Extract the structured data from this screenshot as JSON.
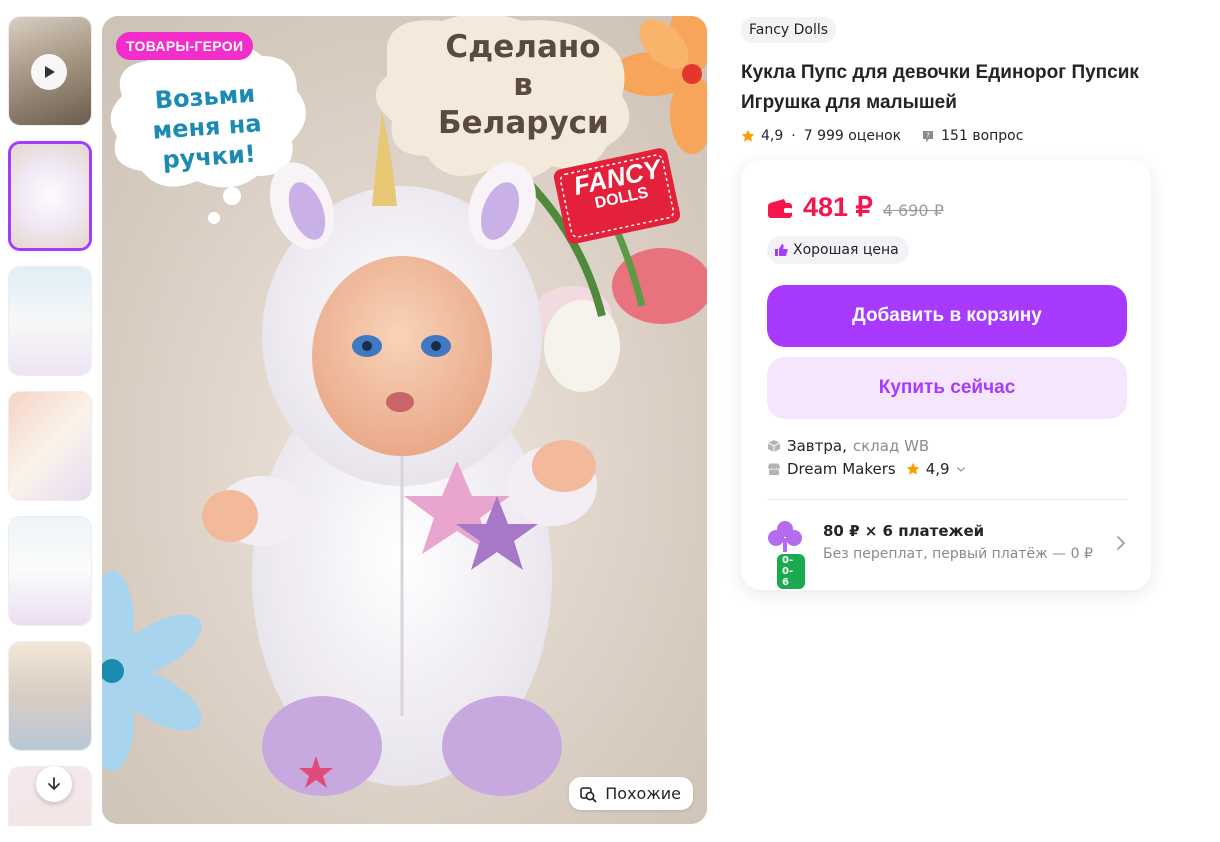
{
  "gallery": {
    "thumbnails": [
      {
        "name": "video",
        "active": false
      },
      {
        "name": "photo-1",
        "active": true
      },
      {
        "name": "photo-2",
        "active": false
      },
      {
        "name": "photo-3",
        "active": false
      },
      {
        "name": "photo-4",
        "active": false
      },
      {
        "name": "photo-5",
        "active": false
      },
      {
        "name": "photo-6",
        "active": false
      }
    ],
    "play_icon": "play-icon",
    "down_icon": "arrow-down-icon"
  },
  "main_image": {
    "badge": "ТОВАРЫ-ГЕРОИ",
    "cloud_text": "Возьми меня на ручки!",
    "made_in_text": "Сделано в Беларуси",
    "logo_line1": "FANCY",
    "logo_line2": "DOLLS",
    "similar_label": "Похожие",
    "similar_icon": "similar-search-icon"
  },
  "product": {
    "brand": "Fancy Dolls",
    "title": "Кукла Пупс для девочки Единорог Пупсик Игрушка для малышей",
    "rating": "4,9",
    "reviews": "7 999 оценок",
    "questions": "151 вопрос"
  },
  "offer": {
    "price": "481 ₽",
    "old_price": "4 690 ₽",
    "good_price_label": "Хорошая цена",
    "add_to_cart": "Добавить в корзину",
    "buy_now": "Купить сейчас",
    "delivery_day": "Завтра,",
    "delivery_warehouse": "склад WB",
    "seller_name": "Dream Makers",
    "seller_rating": "4,9",
    "installment_amount": "80 ₽ × 6 платежей",
    "installment_note": "Без переплат, первый платёж — 0 ₽",
    "installment_badge": "0-0-6"
  },
  "colors": {
    "accent": "#a73afd",
    "accent_light": "#f5e6fe",
    "price": "#f4164e",
    "star": "#ff9d00",
    "badge_pink": "#f12ecb",
    "installment_green": "#1aaa4f"
  }
}
